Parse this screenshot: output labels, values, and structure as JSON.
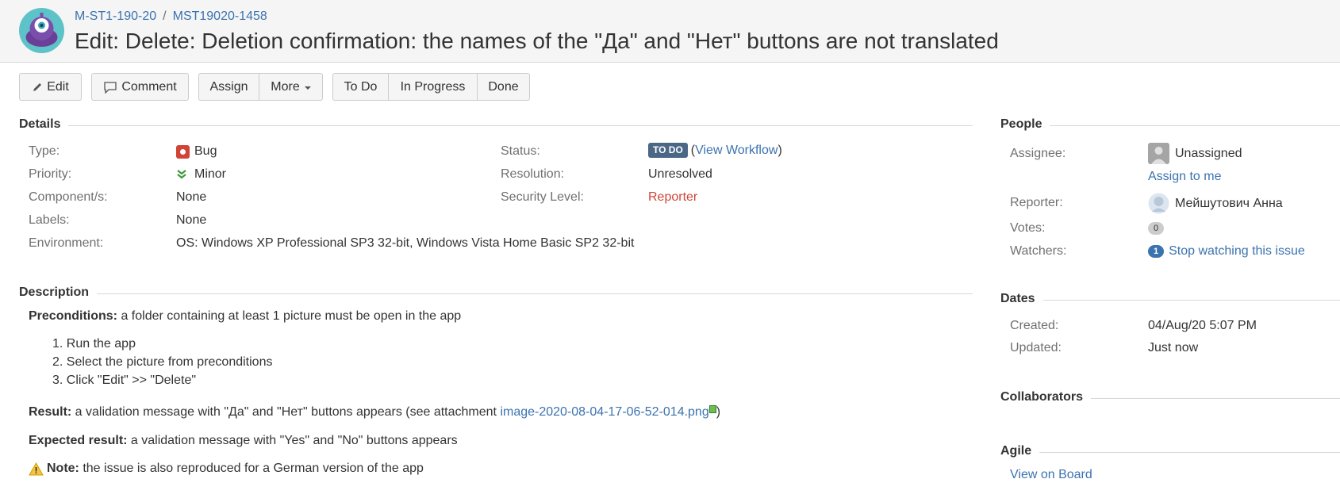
{
  "header": {
    "project_crumb": "M-ST1-190-20",
    "issue_key": "MST19020-1458",
    "summary": "Edit: Delete: Deletion confirmation: the names of the \"Да\" and \"Нет\" buttons are not translated"
  },
  "toolbar": {
    "edit": "Edit",
    "comment": "Comment",
    "assign": "Assign",
    "more": "More",
    "todo": "To Do",
    "in_progress": "In Progress",
    "done": "Done"
  },
  "details": {
    "heading": "Details",
    "type_label": "Type:",
    "type_value": "Bug",
    "priority_label": "Priority:",
    "priority_value": "Minor",
    "components_label": "Component/s:",
    "components_value": "None",
    "labels_label": "Labels:",
    "labels_value": "None",
    "environment_label": "Environment:",
    "environment_value": "OS: Windows XP Professional SP3 32-bit, Windows Vista Home Basic SP2 32-bit",
    "status_label": "Status:",
    "status_value": "TO DO",
    "view_workflow_open": "(",
    "view_workflow": "View Workflow",
    "view_workflow_close": ")",
    "resolution_label": "Resolution:",
    "resolution_value": "Unresolved",
    "security_label": "Security Level:",
    "security_value": "Reporter"
  },
  "description": {
    "heading": "Description",
    "preconditions_label": "Preconditions:",
    "preconditions_text": " a folder containing at least 1 picture must be open in the app",
    "steps": [
      "1. Run the app",
      "2. Select the picture from preconditions",
      "3. Click \"Edit\" >> \"Delete\""
    ],
    "result_label": "Result:",
    "result_text": " a validation message with \"Да\" and \"Нет\" buttons appears (see attachment ",
    "attachment_link": "image-2020-08-04-17-06-52-014.png",
    "result_close": ")",
    "expected_label": "Expected result:",
    "expected_text": " a validation message with \"Yes\" and \"No\" buttons appears",
    "note_label": "Note:",
    "note_text": " the issue is also reproduced for a German version of the app"
  },
  "people": {
    "heading": "People",
    "assignee_label": "Assignee:",
    "assignee_value": "Unassigned",
    "assign_to_me": "Assign to me",
    "reporter_label": "Reporter:",
    "reporter_value": "Мейшутович Анна",
    "votes_label": "Votes:",
    "votes_value": "0",
    "watchers_label": "Watchers:",
    "watchers_count": "1",
    "watchers_link": "Stop watching this issue"
  },
  "dates": {
    "heading": "Dates",
    "created_label": "Created:",
    "created_value": "04/Aug/20 5:07 PM",
    "updated_label": "Updated:",
    "updated_value": "Just now"
  },
  "collaborators": {
    "heading": "Collaborators"
  },
  "agile": {
    "heading": "Agile",
    "view_on_board": "View on Board"
  },
  "colors": {
    "link": "#3b73af",
    "lozenge": "#4a6785",
    "bug": "#d04437",
    "priority": "#3c9a3c"
  }
}
